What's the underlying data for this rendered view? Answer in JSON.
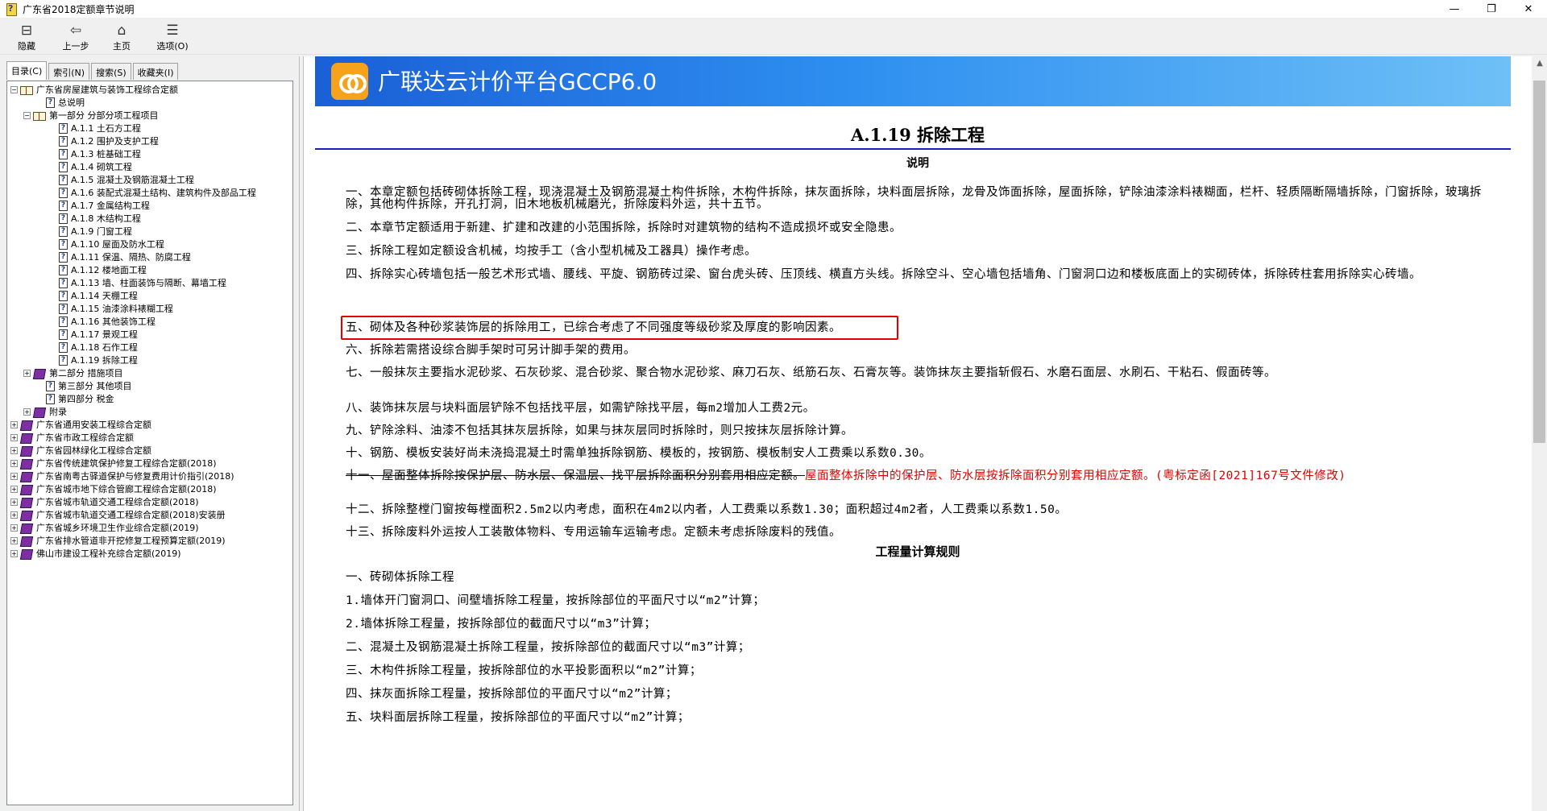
{
  "window": {
    "title": "广东省2018定额章节说明",
    "controls": [
      "—",
      "❐",
      "✕"
    ]
  },
  "toolbar": {
    "buttons": [
      {
        "label": "隐藏",
        "icon": "hide-icon"
      },
      {
        "label": "上一步",
        "icon": "back-arrow-icon"
      },
      {
        "label": "主页",
        "icon": "home-icon"
      },
      {
        "label": "选项(O)",
        "icon": "options-icon"
      }
    ]
  },
  "tabs": [
    "目录(C)",
    "索引(N)",
    "搜索(S)",
    "收藏夹(I)"
  ],
  "tree": [
    {
      "text": "广东省房屋建筑与装饰工程综合定额",
      "level": 0,
      "exp": "⊟",
      "icon": "open"
    },
    {
      "text": "总说明",
      "level": 2,
      "exp": "",
      "icon": "doc"
    },
    {
      "text": "第一部分  分部分项工程项目",
      "level": 1,
      "exp": "⊟",
      "icon": "open"
    },
    {
      "text": "A.1.1 土石方工程",
      "level": 3,
      "exp": "",
      "icon": "doc"
    },
    {
      "text": "A.1.2 围护及支护工程",
      "level": 3,
      "exp": "",
      "icon": "doc"
    },
    {
      "text": "A.1.3 桩基础工程",
      "level": 3,
      "exp": "",
      "icon": "doc"
    },
    {
      "text": "A.1.4 砌筑工程",
      "level": 3,
      "exp": "",
      "icon": "doc"
    },
    {
      "text": "A.1.5 混凝土及钢筋混凝土工程",
      "level": 3,
      "exp": "",
      "icon": "doc"
    },
    {
      "text": "A.1.6 装配式混凝土结构、建筑构件及部品工程",
      "level": 3,
      "exp": "",
      "icon": "doc"
    },
    {
      "text": "A.1.7 金属结构工程",
      "level": 3,
      "exp": "",
      "icon": "doc"
    },
    {
      "text": "A.1.8 木结构工程",
      "level": 3,
      "exp": "",
      "icon": "doc"
    },
    {
      "text": "A.1.9 门窗工程",
      "level": 3,
      "exp": "",
      "icon": "doc"
    },
    {
      "text": "A.1.10 屋面及防水工程",
      "level": 3,
      "exp": "",
      "icon": "doc"
    },
    {
      "text": "A.1.11 保温、隔热、防腐工程",
      "level": 3,
      "exp": "",
      "icon": "doc"
    },
    {
      "text": "A.1.12 楼地面工程",
      "level": 3,
      "exp": "",
      "icon": "doc"
    },
    {
      "text": "A.1.13 墙、柱面装饰与隔断、幕墙工程",
      "level": 3,
      "exp": "",
      "icon": "doc"
    },
    {
      "text": "A.1.14 天棚工程",
      "level": 3,
      "exp": "",
      "icon": "doc"
    },
    {
      "text": "A.1.15 油漆涂料裱糊工程",
      "level": 3,
      "exp": "",
      "icon": "doc"
    },
    {
      "text": "A.1.16 其他装饰工程",
      "level": 3,
      "exp": "",
      "icon": "doc"
    },
    {
      "text": "A.1.17 景观工程",
      "level": 3,
      "exp": "",
      "icon": "doc"
    },
    {
      "text": "A.1.18 石作工程",
      "level": 3,
      "exp": "",
      "icon": "doc"
    },
    {
      "text": "A.1.19 拆除工程",
      "level": 3,
      "exp": "",
      "icon": "doc",
      "selected": true
    },
    {
      "text": "第二部分  措施项目",
      "level": 1,
      "exp": "⊞",
      "icon": "closed"
    },
    {
      "text": "第三部分  其他项目",
      "level": 2,
      "exp": "",
      "icon": "doc"
    },
    {
      "text": "第四部分  税金",
      "level": 2,
      "exp": "",
      "icon": "doc"
    },
    {
      "text": "附录",
      "level": 1,
      "exp": "⊞",
      "icon": "closed"
    },
    {
      "text": "广东省通用安装工程综合定额",
      "level": 0,
      "exp": "⊞",
      "icon": "closed"
    },
    {
      "text": "广东省市政工程综合定额",
      "level": 0,
      "exp": "⊞",
      "icon": "closed"
    },
    {
      "text": "广东省园林绿化工程综合定额",
      "level": 0,
      "exp": "⊞",
      "icon": "closed"
    },
    {
      "text": "广东省传统建筑保护修复工程综合定额(2018)",
      "level": 0,
      "exp": "⊞",
      "icon": "closed"
    },
    {
      "text": "广东省南粤古驿道保护与修复费用计价指引(2018)",
      "level": 0,
      "exp": "⊞",
      "icon": "closed"
    },
    {
      "text": "广东省城市地下综合管廊工程综合定额(2018)",
      "level": 0,
      "exp": "⊞",
      "icon": "closed"
    },
    {
      "text": "广东省城市轨道交通工程综合定额(2018)",
      "level": 0,
      "exp": "⊞",
      "icon": "closed"
    },
    {
      "text": "广东省城市轨道交通工程综合定额(2018)安装册",
      "level": 0,
      "exp": "⊞",
      "icon": "closed"
    },
    {
      "text": "广东省城乡环境卫生作业综合定额(2019)",
      "level": 0,
      "exp": "⊞",
      "icon": "closed"
    },
    {
      "text": "广东省排水管道非开挖修复工程预算定额(2019)",
      "level": 0,
      "exp": "⊞",
      "icon": "closed"
    },
    {
      "text": "佛山市建设工程补充综合定额(2019)",
      "level": 0,
      "exp": "⊞",
      "icon": "closed"
    }
  ],
  "banner": {
    "title": "广联达云计价平台GCCP6.0"
  },
  "doc": {
    "heading": "A.1.19 拆除工程",
    "subheading": "说明",
    "paragraphs": [
      "一、本章定额包括砖砌体拆除工程，现浇混凝土及钢筋混凝土构件拆除，木构件拆除，抹灰面拆除，块料面层拆除，龙骨及饰面拆除，屋面拆除，铲除油漆涂料裱糊面，栏杆、轻质隔断隔墙拆除，门窗拆除，玻璃拆除，其他构件拆除，开孔打洞，旧木地板机械磨光，折除废料外运，共十五节。",
      "二、本章节定额适用于新建、扩建和改建的小范围拆除，拆除时对建筑物的结构不造成损坏或安全隐患。",
      "三、拆除工程如定额设含机械，均按手工（含小型机械及工器具）操作考虑。",
      "四、拆除实心砖墙包括一般艺术形式墙、腰线、平旋、钢筋砖过梁、窗台虎头砖、压顶线、横直方头线。拆除空斗、空心墙包括墙角、门窗洞口边和楼板底面上的实砌砖体，拆除砖柱套用拆除实心砖墙。",
      "五、砌体及各种砂浆装饰层的拆除用工，已综合考虑了不同强度等级砂浆及厚度的影响因素。",
      "六、拆除若需搭设综合脚手架时可另计脚手架的费用。",
      "七、一般抹灰主要指水泥砂浆、石灰砂浆、混合砂浆、聚合物水泥砂浆、麻刀石灰、纸筋石灰、石膏灰等。装饰抹灰主要指斩假石、水磨石面层、水刷石、干粘石、假面砖等。",
      "八、装饰抹灰层与块料面层铲除不包括找平层，如需铲除找平层，每m2增加人工费2元。",
      "九、铲除涂料、油漆不包括其抹灰层拆除，如果与抹灰层同时拆除时，则只按抹灰层拆除计算。",
      "十、钢筋、模板安装好尚未浇捣混凝土时需单独拆除钢筋、模板的，按钢筋、模板制安人工费乘以系数0.30。"
    ],
    "p11_struck": "十一、屋面整体拆除按保护层、防水层、保温层、找平层拆除面积分别套用相应定额。",
    "p11_red": "屋面整体拆除中的保护层、防水层按拆除面积分别套用相应定额。(粤标定函[2021]167号文件修改)",
    "p12": "十二、拆除整樘门窗按每樘面积2.5m2以内考虑，面积在4m2以内者，人工费乘以系数1.30；面积超过4m2者，人工费乘以系数1.50。",
    "p13": "十三、拆除废料外运按人工装散体物料、专用运输车运输考虑。定额未考虑拆除废料的残值。",
    "section2": "工程量计算规则",
    "rules": [
      "一、砖砌体拆除工程",
      "1.墙体开门窗洞口、间壁墙拆除工程量，按拆除部位的平面尺寸以“m2”计算；",
      "2.墙体拆除工程量，按拆除部位的截面尺寸以“m3”计算；",
      "二、混凝土及钢筋混凝土拆除工程量，按拆除部位的截面尺寸以“m3”计算；",
      "三、木构件拆除工程量，按拆除部位的水平投影面积以“m2”计算；",
      "四、抹灰面拆除工程量，按拆除部位的平面尺寸以“m2”计算；",
      "五、块料面层拆除工程量，按拆除部位的平面尺寸以“m2”计算；"
    ]
  },
  "colors": {
    "highlight_box": "#e00000",
    "revision_text": "#e00000",
    "rule_line": "#1b1bc0"
  }
}
